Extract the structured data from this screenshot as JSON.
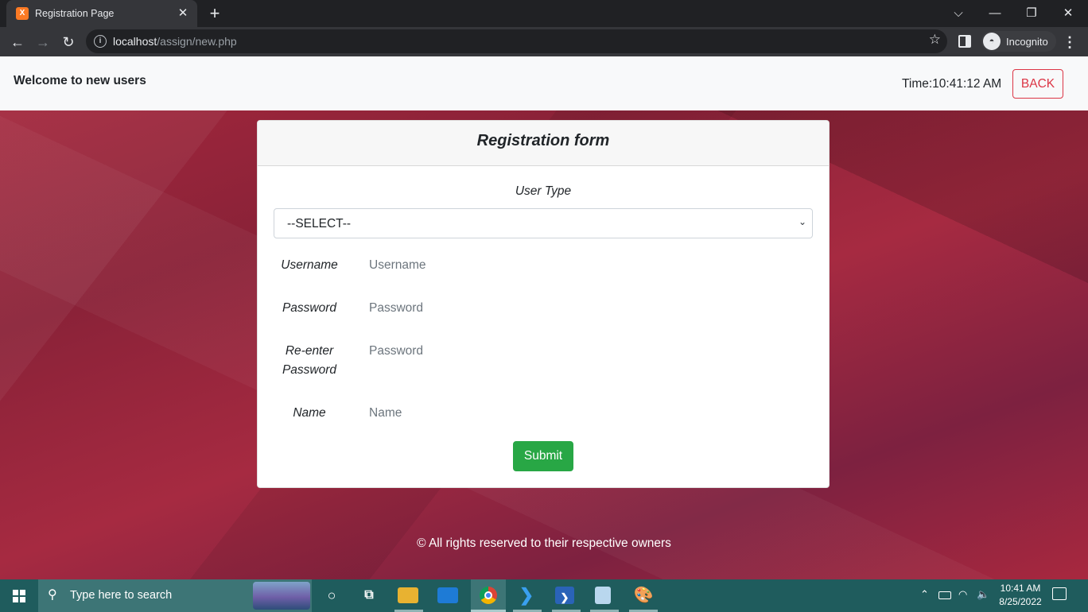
{
  "browser": {
    "tab_title": "Registration Page",
    "tab_close": "✕",
    "new_tab": "+",
    "url_host": "localhost",
    "url_path": "/assign/new.php",
    "profile_label": "Incognito",
    "window_controls": {
      "chevron": "⌵",
      "minimize": "—",
      "restore": "❐",
      "close": "✕"
    }
  },
  "header": {
    "welcome": "Welcome to new users",
    "time": "Time:10:41:12 AM",
    "back_label": "BACK"
  },
  "form": {
    "title": "Registration form",
    "user_type_label": "User Type",
    "user_type_value": "--SELECT--",
    "fields": [
      {
        "label": "Username",
        "placeholder": "Username"
      },
      {
        "label": "Password",
        "placeholder": "Password"
      },
      {
        "label": "Re-enter Password",
        "placeholder": "Password"
      },
      {
        "label": "Name",
        "placeholder": "Name"
      }
    ],
    "submit_label": "Submit"
  },
  "footer": {
    "text": "© All rights reserved to their respective owners"
  },
  "taskbar": {
    "search_placeholder": "Type here to search",
    "clock_time": "10:41 AM",
    "clock_date": "8/25/2022",
    "pinned_apps": [
      "cortana-icon",
      "task-view-icon",
      "file-explorer-icon",
      "remote-desktop-icon",
      "chrome-icon",
      "vscode-icon",
      "powershell-icon",
      "notepad-icon",
      "paint-icon"
    ]
  },
  "colors": {
    "accent_red": "#dc3545",
    "submit_green": "#28a745",
    "page_background": "#a8283d",
    "taskbar": "#1f5c5d"
  }
}
